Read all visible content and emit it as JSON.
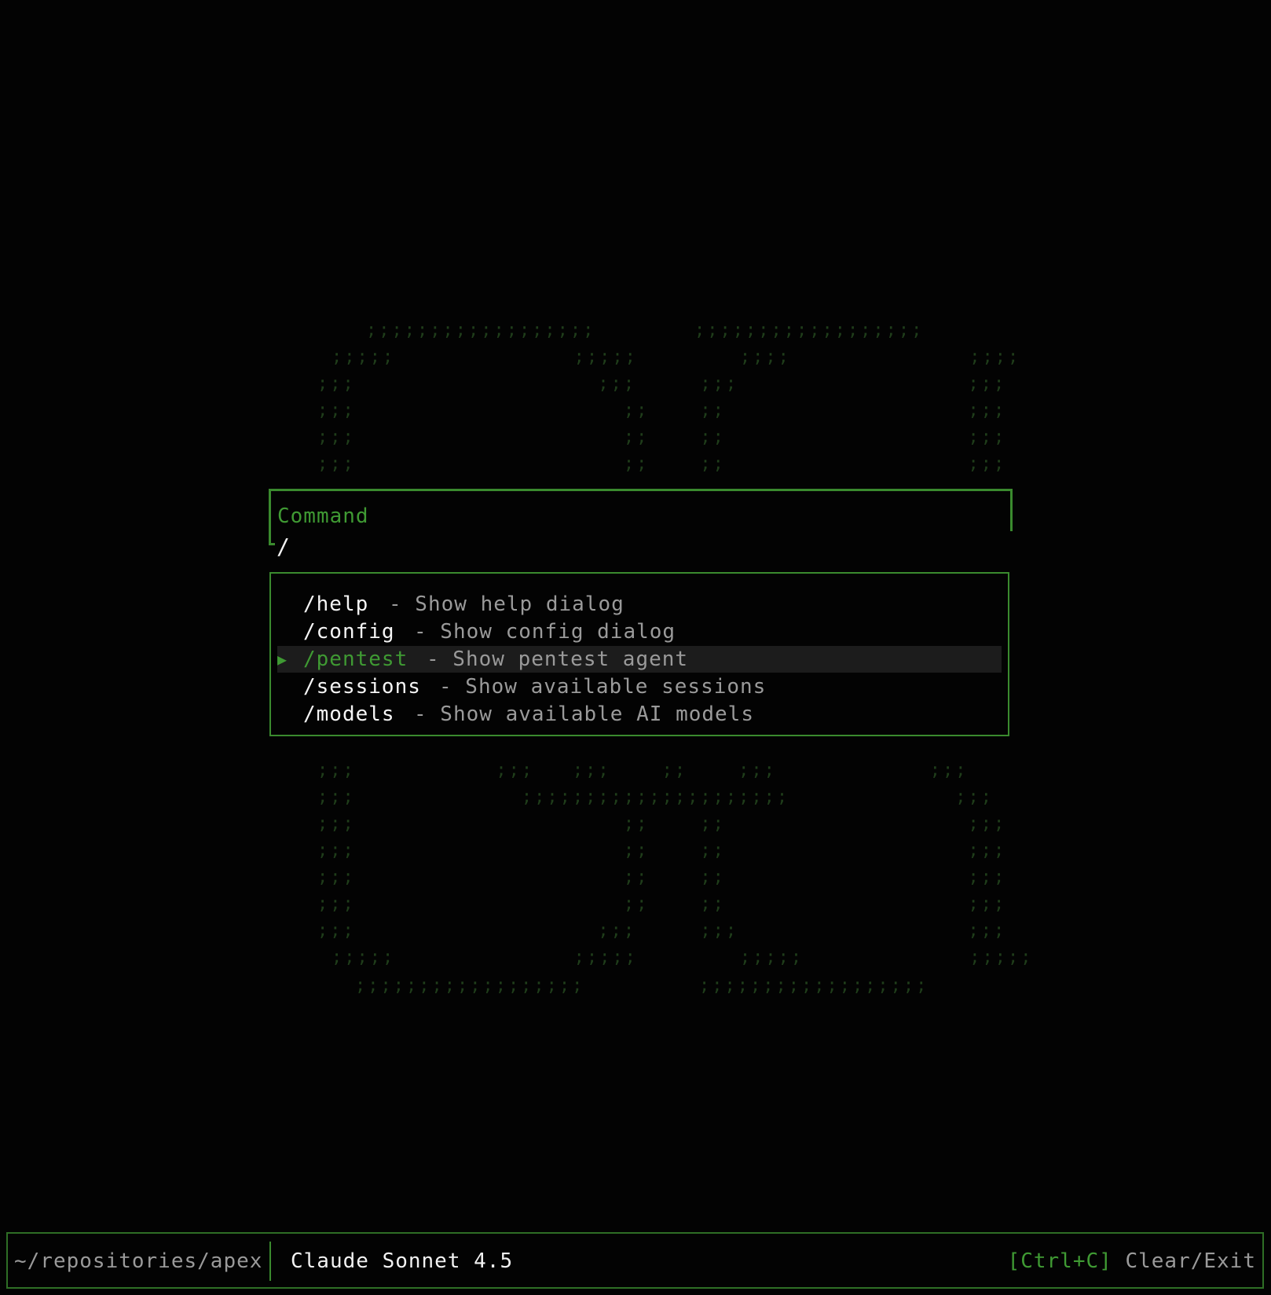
{
  "colors": {
    "background": "#030303",
    "accent_green": "#3f9a33",
    "border_green": "#3a8a2e",
    "ascii_dim_green": "#1f3d1a",
    "text_primary": "#f2f2f2",
    "text_muted": "#9a9a9a",
    "selected_row_bg": "#1c1c1c"
  },
  "command_box": {
    "label": "Command",
    "value": "/"
  },
  "menu": {
    "items": [
      {
        "command": "/help",
        "description": "- Show help dialog",
        "selected": false
      },
      {
        "command": "/config",
        "description": "- Show config dialog",
        "selected": false
      },
      {
        "command": "/pentest",
        "description": "- Show pentest agent",
        "selected": true
      },
      {
        "command": "/sessions",
        "description": "- Show available sessions",
        "selected": false
      },
      {
        "command": "/models",
        "description": "- Show available AI models",
        "selected": false
      }
    ],
    "selection_marker": "▶"
  },
  "status_bar": {
    "path": "~/repositories/apex",
    "model": "Claude Sonnet 4.5",
    "shortcut_key": "[Ctrl+C]",
    "shortcut_action": "Clear/Exit"
  }
}
